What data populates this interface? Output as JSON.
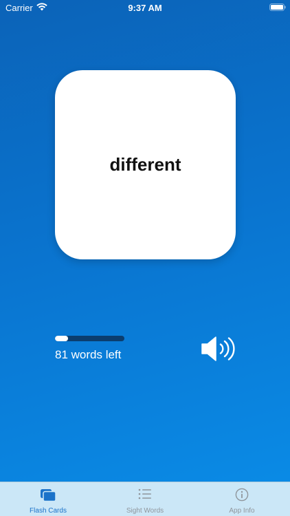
{
  "status_bar": {
    "carrier": "Carrier",
    "time": "9:37 AM"
  },
  "card": {
    "word": "different"
  },
  "progress": {
    "fraction": 0.19,
    "words_left": "81 words left"
  },
  "tabs": [
    {
      "label": "Flash Cards",
      "icon": "cards-icon",
      "active": true
    },
    {
      "label": "Sight Words",
      "icon": "list-icon",
      "active": false
    },
    {
      "label": "App Info",
      "icon": "info-icon",
      "active": false
    }
  ],
  "colors": {
    "accent": "#1a72c9",
    "tab_bar_bg": "#cbe7f7",
    "progress_track": "#0b3d6e"
  }
}
